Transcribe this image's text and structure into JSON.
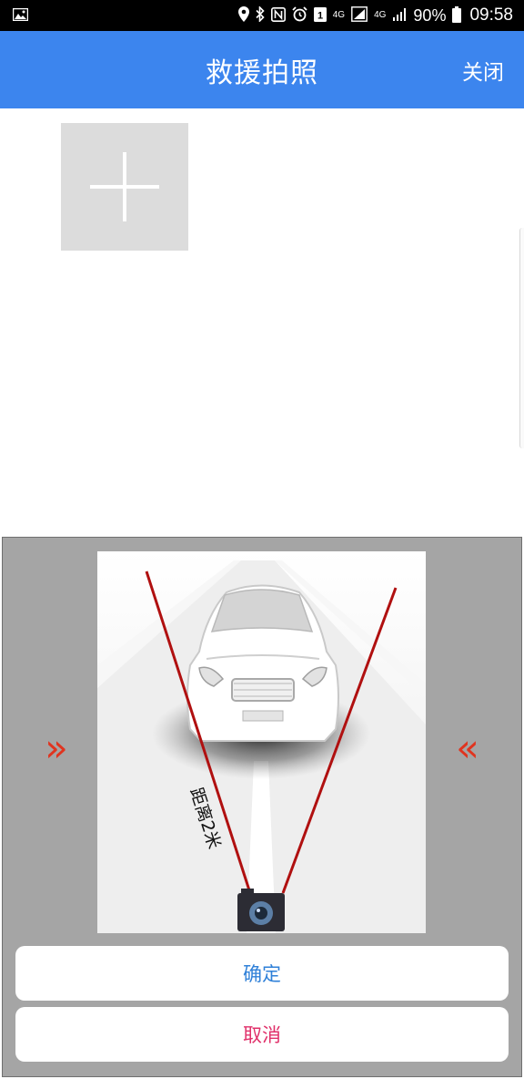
{
  "status_bar": {
    "battery": "90%",
    "time": "09:58",
    "network_1": "4G",
    "network_2": "4G"
  },
  "app_bar": {
    "title": "救援拍照",
    "close_label": "关闭",
    "background": "#3c85ee"
  },
  "photo": {
    "add_icon": "plus-icon"
  },
  "guide": {
    "distance_label": "距离2米",
    "left_arrow": "»",
    "right_arrow": "«",
    "arrow_color": "#e0341f",
    "line_color": "#b01010"
  },
  "sheet": {
    "confirm_label": "确定",
    "confirm_color": "#2f80d8",
    "cancel_label": "取消",
    "cancel_color": "#e0306a"
  }
}
